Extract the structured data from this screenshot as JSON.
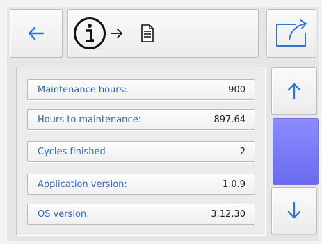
{
  "header": {
    "back_icon": "back-arrow-icon",
    "info_icon": "info-circle-icon",
    "arrow_right_icon": "right-arrow-icon",
    "document_icon": "document-icon",
    "export_icon": "export-window-icon"
  },
  "info_rows": [
    {
      "label": "Maintenance hours:",
      "value": "900"
    },
    {
      "label": "Hours to maintenance:",
      "value": "897.64"
    },
    {
      "label": "Cycles finished",
      "value": "2"
    },
    {
      "label": "Application version:",
      "value": "1.0.9"
    },
    {
      "label": "OS version:",
      "value": "3.12.30"
    }
  ],
  "scroll": {
    "up_icon": "up-arrow-icon",
    "down_icon": "down-arrow-icon"
  },
  "colors": {
    "accent_blue": "#2f76d2",
    "scroll_thumb": "#7b7bf8",
    "label_text": "#2f67b6"
  }
}
